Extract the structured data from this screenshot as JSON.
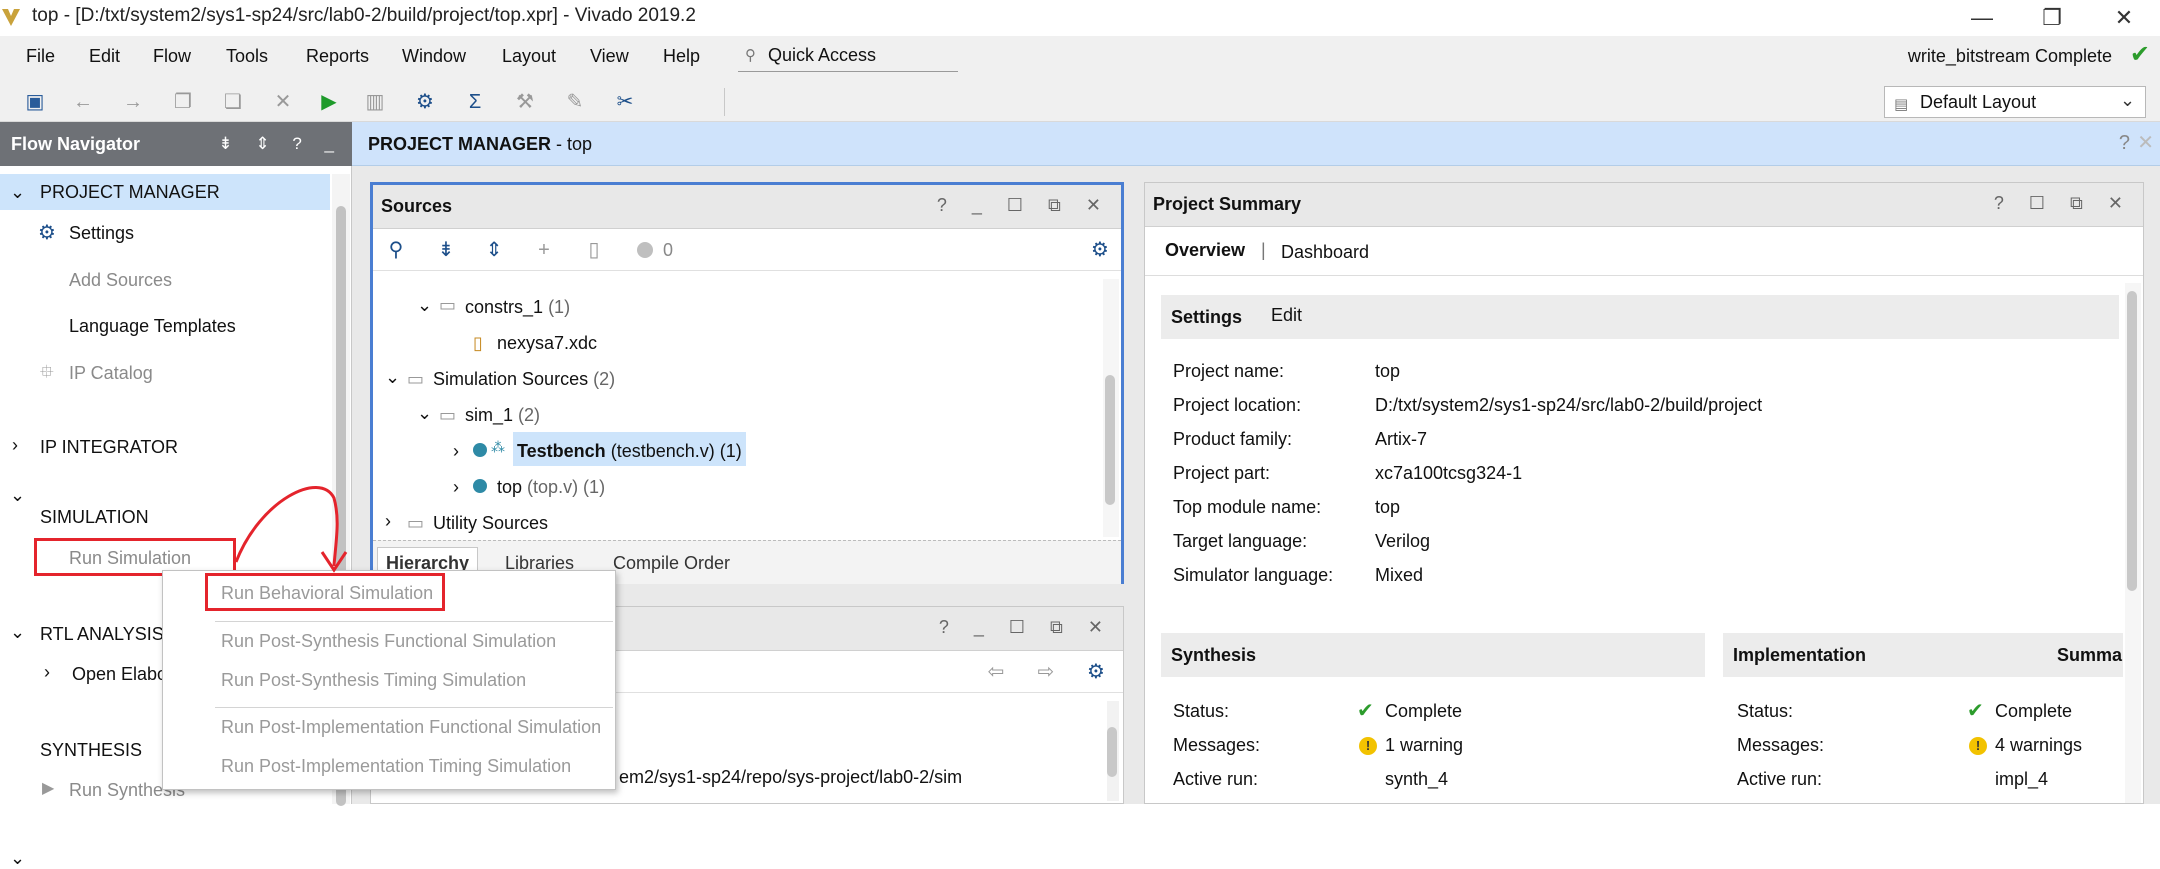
{
  "window": {
    "title": "top - [D:/txt/system2/sys1-sp24/src/lab0-2/build/project/top.xpr] - Vivado 2019.2",
    "controls": [
      "—",
      "❐",
      "✕"
    ]
  },
  "menu": {
    "items": [
      "File",
      "Edit",
      "Flow",
      "Tools",
      "Reports",
      "Window",
      "Layout",
      "View",
      "Help"
    ],
    "quick_access": "Quick Access",
    "status": "write_bitstream Complete"
  },
  "toolbar": {
    "layout_select": "Default Layout"
  },
  "flow_navigator": {
    "title": "Flow Navigator",
    "icons": "⇟ ⇕ ? _",
    "project_manager": "PROJECT MANAGER",
    "settings": "Settings",
    "add_sources": "Add Sources",
    "language_templates": "Language Templates",
    "ip_catalog": "IP Catalog",
    "ip_integrator": "IP INTEGRATOR",
    "simulation": "SIMULATION",
    "run_simulation": "Run Simulation",
    "rtl_analysis": "RTL ANALYSIS",
    "open_elab": "Open Elabo",
    "synthesis": "SYNTHESIS",
    "run_synthesis": "Run Synthesis"
  },
  "pm_bar": {
    "title_bold": "PROJECT MANAGER",
    "title_rest": " - top",
    "help": "?",
    "close": "✕"
  },
  "sources": {
    "title": "Sources",
    "header_icons": "? _ ☐ ⧉ ✕",
    "badge_count": "0",
    "tree": {
      "constrs": "constrs_1",
      "constrs_count": "(1)",
      "xdc": "nexysa7.xdc",
      "sim_sources": "Simulation Sources",
      "sim_sources_count": "(2)",
      "sim1": "sim_1",
      "sim1_count": "(2)",
      "testbench": "Testbench",
      "testbench_file": "(testbench.v) (1)",
      "top": "top",
      "top_file": "(top.v) (1)",
      "utility": "Utility Sources"
    },
    "tabs": [
      "Hierarchy",
      "Libraries",
      "Compile Order"
    ]
  },
  "lower_panel": {
    "header_icons": "? _ ☐ ⧉ ✕",
    "path_text": "em2/sys1-sp24/repo/sys-project/lab0-2/sim"
  },
  "summary": {
    "title": "Project Summary",
    "header_icons": "? ☐ ⧉ ✕",
    "tab_overview": "Overview",
    "tab_sep": "|",
    "tab_dashboard": "Dashboard",
    "settings_title": "Settings",
    "edit": "Edit",
    "rows": [
      {
        "label": "Project name:",
        "value": "top"
      },
      {
        "label": "Project location:",
        "value": "D:/txt/system2/sys1-sp24/src/lab0-2/build/project"
      },
      {
        "label": "Product family:",
        "value": "Artix-7"
      },
      {
        "label": "Project part:",
        "value": "xc7a100tcsg324-1"
      },
      {
        "label": "Top module name:",
        "value": "top"
      },
      {
        "label": "Target language:",
        "value": "Verilog"
      },
      {
        "label": "Simulator language:",
        "value": "Mixed"
      }
    ],
    "synthesis": {
      "title": "Synthesis",
      "status_label": "Status:",
      "status_value": "Complete",
      "messages_label": "Messages:",
      "messages_value": "1 warning",
      "active_label": "Active run:",
      "active_value": "synth_4"
    },
    "implementation": {
      "title": "Implementation",
      "summary_cut": "Summa",
      "status_label": "Status:",
      "status_value": "Complete",
      "messages_label": "Messages:",
      "messages_value": "4 warnings",
      "active_label": "Active run:",
      "active_value": "impl_4"
    }
  },
  "context_menu": {
    "items": [
      "Run Behavioral Simulation",
      "Run Post-Synthesis Functional Simulation",
      "Run Post-Synthesis Timing Simulation",
      "Run Post-Implementation Functional Simulation",
      "Run Post-Implementation Timing Simulation"
    ]
  },
  "colors": {
    "accent_blue": "#4a7ed2",
    "selection": "#cde4fb",
    "annotation_red": "#e4242c",
    "success_green": "#2c9c2c",
    "warning_yellow": "#f2c200",
    "link": "#2a66cc"
  }
}
